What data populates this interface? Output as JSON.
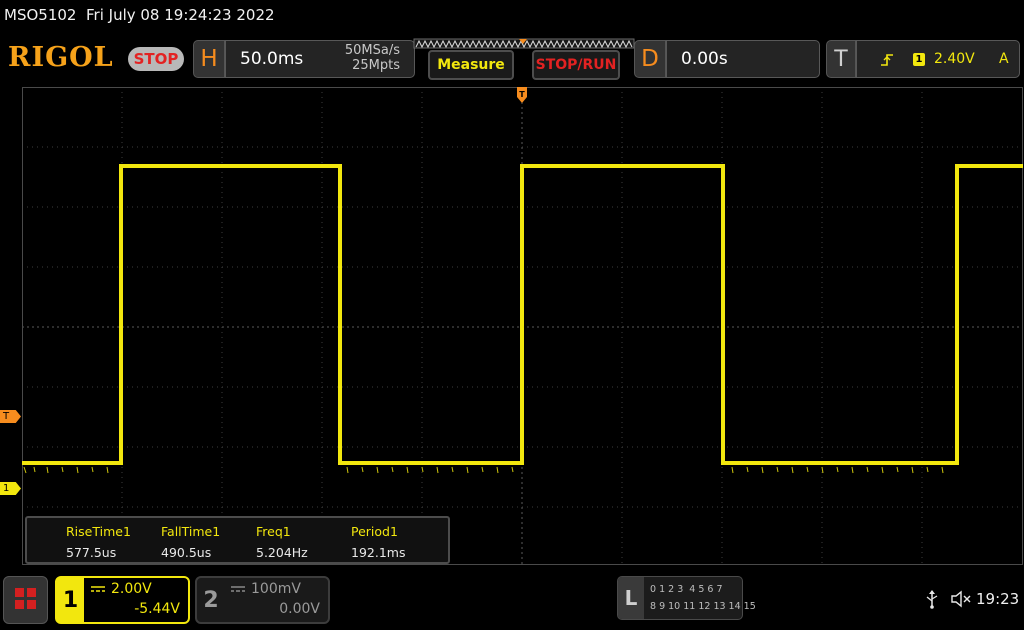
{
  "header": {
    "model": "MSO5102",
    "datetime": "Fri July 08 19:24:23 2022",
    "brand": "RIGOL",
    "run_state": "STOP"
  },
  "horizontal": {
    "key": "H",
    "timebase": "50.0ms",
    "sample_rate": "50MSa/s",
    "memory_depth": "25Mpts"
  },
  "buttons": {
    "measure": "Measure",
    "stop_run": "STOP/RUN"
  },
  "delay": {
    "key": "D",
    "value": "0.00s"
  },
  "trigger": {
    "key": "T",
    "source": "1",
    "level": "2.40V",
    "mode": "A"
  },
  "markers": {
    "trigger_level": "T",
    "channel1": "1"
  },
  "measurements": {
    "headers": [
      "RiseTime1",
      "FallTime1",
      "Freq1",
      "Period1"
    ],
    "values": [
      "577.5us",
      "490.5us",
      "5.204Hz",
      "192.1ms"
    ]
  },
  "channels": {
    "ch1": {
      "number": "1",
      "scale": "2.00V",
      "offset": "-5.44V"
    },
    "ch2": {
      "number": "2",
      "scale": "100mV",
      "offset": "0.00V"
    }
  },
  "logic": {
    "label": "L",
    "row1": "0 1 2 3  4 5 6 7",
    "row2": "8 9 10 11 12 13 14 15"
  },
  "status": {
    "time": "19:23"
  },
  "colors": {
    "ch1": "#f2e70e",
    "accent": "#f68c1e",
    "stop": "#e32222"
  },
  "icons": [
    "menu-icon",
    "usb-icon",
    "speaker-muted-icon",
    "trigger-edge-icon",
    "dc-coupling-icon"
  ]
}
